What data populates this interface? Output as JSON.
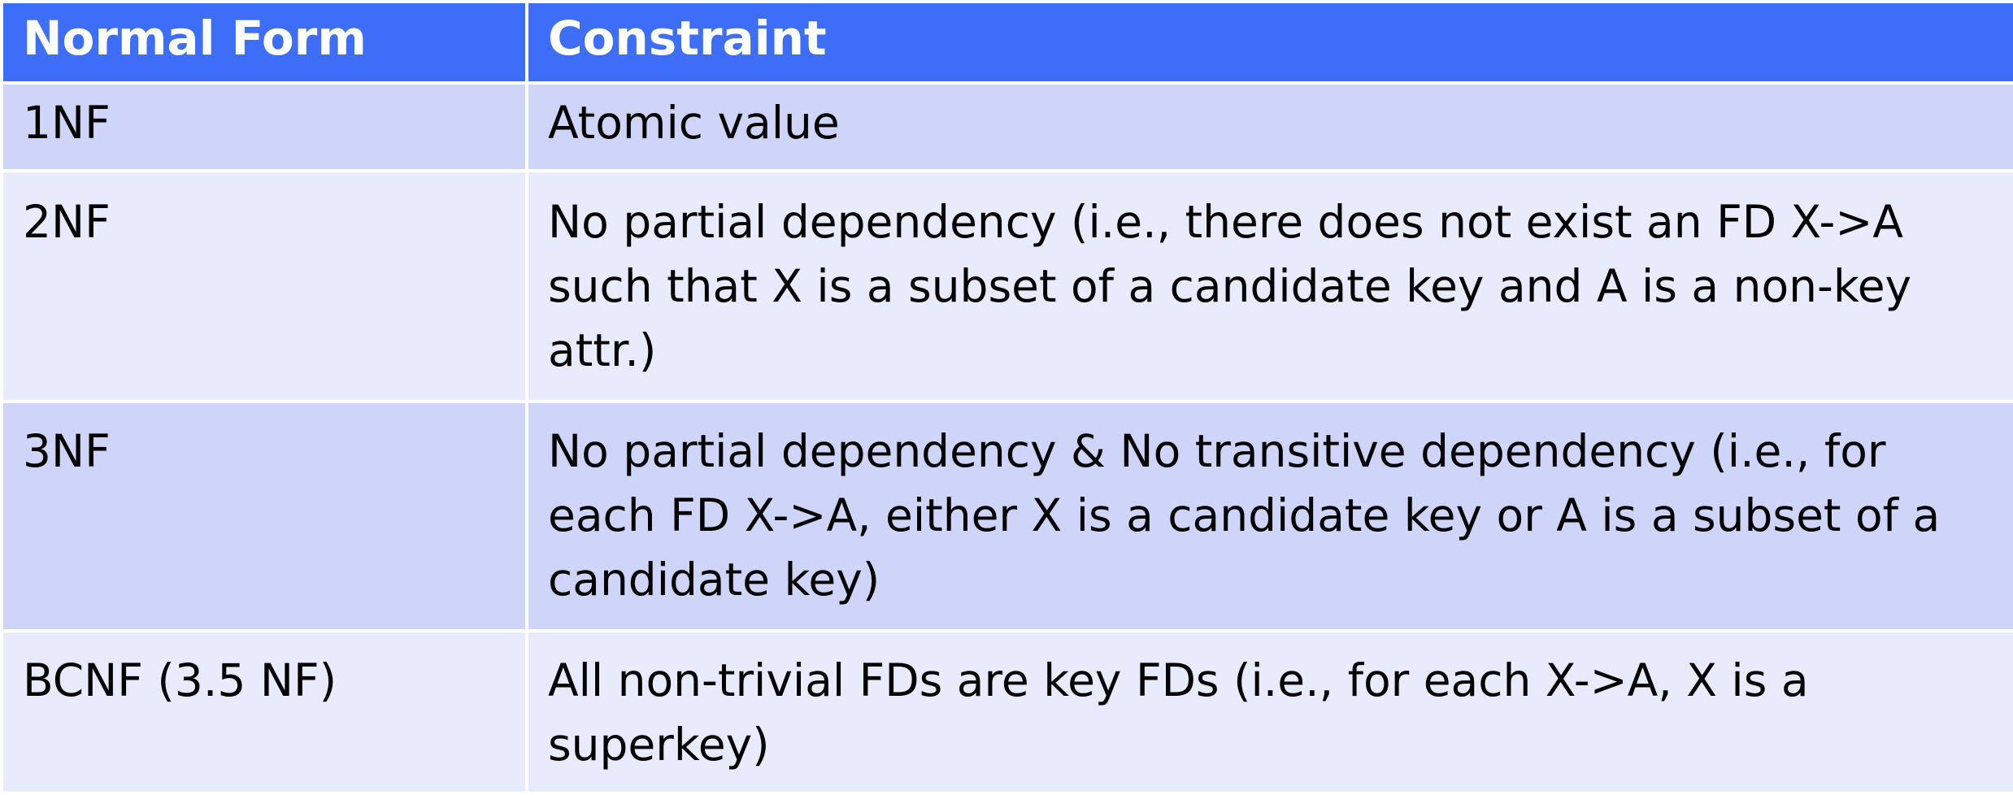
{
  "table": {
    "headers": [
      "Normal Form",
      "Constraint"
    ],
    "rows": [
      {
        "form": "1NF",
        "constraint": "Atomic value"
      },
      {
        "form": "2NF",
        "constraint": "No partial dependency (i.e., there does not exist an FD X->A such that X is a subset of a candidate key and A is a non-key attr.)"
      },
      {
        "form": "3NF",
        "constraint": "No partial dependency & No transitive dependency (i.e., for each FD X->A, either X is a candidate key or A is a subset of a candidate key)"
      },
      {
        "form": "BCNF (3.5 NF)",
        "constraint": "All non-trivial FDs are key FDs (i.e., for each X->A, X is a superkey)"
      }
    ]
  },
  "colors": {
    "header_bg": "#3d6ef5",
    "row_odd_bg": "#ced5f9",
    "row_even_bg": "#e8ebfc",
    "border": "#ffffff"
  }
}
